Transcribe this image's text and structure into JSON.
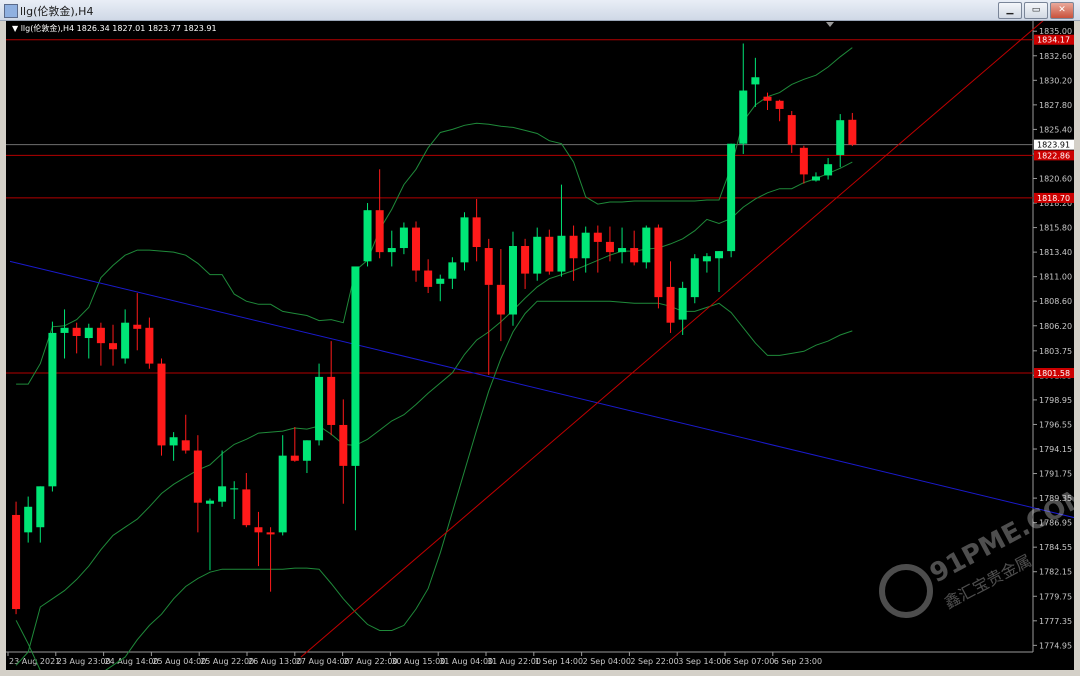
{
  "window": {
    "title": "llg(伦敦金),H4",
    "buttons": [
      "▁",
      "▭",
      "✕"
    ],
    "icons": [
      "minimize-icon",
      "restore-icon",
      "close-icon"
    ]
  },
  "chart_header": {
    "symbol": "llg(伦敦金),H4",
    "ohlc": "1826.34 1827.01 1823.77 1823.91"
  },
  "watermark": {
    "text": "91PME.COM",
    "subtext": "鑫汇宝贵金属"
  },
  "colors": {
    "background": "#000000",
    "bull": "#00e676",
    "bear": "#ff1a1a",
    "bands": "#1f8a3a",
    "hlines": "#b30000",
    "trend_blue": "#1a1acc",
    "trend_red": "#c00000",
    "axis_text": "#c8c8c8"
  },
  "chart_data": {
    "type": "candlestick",
    "title": "llg(伦敦金),H4",
    "ylim": [
      1774.3,
      1836.0
    ],
    "y_ticks": [
      "1835.00",
      "1832.60",
      "1830.20",
      "1827.80",
      "1825.40",
      "1823.00",
      "1820.60",
      "1818.20",
      "1815.80",
      "1813.40",
      "1811.00",
      "1808.60",
      "1806.20",
      "1803.75",
      "1801.35",
      "1798.95",
      "1796.55",
      "1794.15",
      "1791.75",
      "1789.35",
      "1786.95",
      "1784.55",
      "1782.15",
      "1779.75",
      "1777.35",
      "1774.95"
    ],
    "x_labels": [
      "23 Aug 2021",
      "23 Aug 23:00",
      "24 Aug 14:00",
      "25 Aug 04:00",
      "25 Aug 22:00",
      "26 Aug 13:00",
      "27 Aug 04:00",
      "27 Aug 22:00",
      "30 Aug 15:00",
      "31 Aug 04:00",
      "31 Aug 22:00",
      "1 Sep 14:00",
      "2 Sep 04:00",
      "2 Sep 22:00",
      "3 Sep 14:00",
      "6 Sep 07:00",
      "6 Sep 23:00"
    ],
    "price_labels": [
      {
        "price": 1834.17,
        "label": "1834.17",
        "kind": "level"
      },
      {
        "price": 1823.91,
        "label": "1823.91",
        "kind": "current"
      },
      {
        "price": 1822.86,
        "label": "1822.86",
        "kind": "level"
      },
      {
        "price": 1818.7,
        "label": "1818.70",
        "kind": "level"
      },
      {
        "price": 1801.58,
        "label": "1801.58",
        "kind": "level"
      }
    ],
    "candles": [
      {
        "o": 1787.7,
        "h": 1789.0,
        "l": 1778.0,
        "c": 1778.5
      },
      {
        "o": 1786.0,
        "h": 1789.5,
        "l": 1785.0,
        "c": 1788.5
      },
      {
        "o": 1786.5,
        "h": 1790.5,
        "l": 1785.0,
        "c": 1790.5
      },
      {
        "o": 1790.5,
        "h": 1806.6,
        "l": 1790.0,
        "c": 1805.5
      },
      {
        "o": 1805.5,
        "h": 1807.8,
        "l": 1803.0,
        "c": 1806.0
      },
      {
        "o": 1806.0,
        "h": 1806.5,
        "l": 1803.5,
        "c": 1805.2
      },
      {
        "o": 1805.0,
        "h": 1806.4,
        "l": 1803.0,
        "c": 1806.0
      },
      {
        "o": 1806.0,
        "h": 1806.5,
        "l": 1802.3,
        "c": 1804.5
      },
      {
        "o": 1804.5,
        "h": 1806.3,
        "l": 1802.3,
        "c": 1803.9
      },
      {
        "o": 1803.0,
        "h": 1807.8,
        "l": 1802.5,
        "c": 1806.5
      },
      {
        "o": 1806.3,
        "h": 1809.4,
        "l": 1803.8,
        "c": 1805.9
      },
      {
        "o": 1806.0,
        "h": 1807.0,
        "l": 1802.0,
        "c": 1802.5
      },
      {
        "o": 1802.5,
        "h": 1803.0,
        "l": 1793.5,
        "c": 1794.5
      },
      {
        "o": 1794.5,
        "h": 1795.8,
        "l": 1793.0,
        "c": 1795.3
      },
      {
        "o": 1795.0,
        "h": 1797.5,
        "l": 1793.7,
        "c": 1794.0
      },
      {
        "o": 1794.0,
        "h": 1795.5,
        "l": 1786.0,
        "c": 1788.9
      },
      {
        "o": 1788.8,
        "h": 1789.3,
        "l": 1782.3,
        "c": 1789.1
      },
      {
        "o": 1789.0,
        "h": 1794.0,
        "l": 1788.5,
        "c": 1790.5
      },
      {
        "o": 1790.2,
        "h": 1791.0,
        "l": 1787.3,
        "c": 1790.3
      },
      {
        "o": 1790.2,
        "h": 1791.8,
        "l": 1786.5,
        "c": 1786.7
      },
      {
        "o": 1786.5,
        "h": 1788.0,
        "l": 1782.7,
        "c": 1786.0
      },
      {
        "o": 1786.0,
        "h": 1786.5,
        "l": 1780.2,
        "c": 1785.8
      },
      {
        "o": 1786.0,
        "h": 1795.5,
        "l": 1785.7,
        "c": 1793.5
      },
      {
        "o": 1793.5,
        "h": 1796.3,
        "l": 1792.9,
        "c": 1793.0
      },
      {
        "o": 1793.0,
        "h": 1795.0,
        "l": 1791.8,
        "c": 1795.0
      },
      {
        "o": 1795.0,
        "h": 1802.5,
        "l": 1794.5,
        "c": 1801.2
      },
      {
        "o": 1801.2,
        "h": 1804.7,
        "l": 1795.5,
        "c": 1796.5
      },
      {
        "o": 1796.5,
        "h": 1799.0,
        "l": 1788.8,
        "c": 1792.5
      },
      {
        "o": 1792.5,
        "h": 1812.0,
        "l": 1786.2,
        "c": 1812.0
      },
      {
        "o": 1812.5,
        "h": 1818.2,
        "l": 1812.0,
        "c": 1817.5
      },
      {
        "o": 1817.5,
        "h": 1821.5,
        "l": 1812.8,
        "c": 1813.4
      },
      {
        "o": 1813.4,
        "h": 1815.5,
        "l": 1812.0,
        "c": 1813.8
      },
      {
        "o": 1813.8,
        "h": 1816.3,
        "l": 1813.2,
        "c": 1815.8
      },
      {
        "o": 1815.8,
        "h": 1816.4,
        "l": 1810.5,
        "c": 1811.6
      },
      {
        "o": 1811.6,
        "h": 1812.7,
        "l": 1809.4,
        "c": 1810.0
      },
      {
        "o": 1810.3,
        "h": 1811.2,
        "l": 1808.6,
        "c": 1810.8
      },
      {
        "o": 1810.8,
        "h": 1812.9,
        "l": 1809.8,
        "c": 1812.4
      },
      {
        "o": 1812.4,
        "h": 1817.3,
        "l": 1811.6,
        "c": 1816.8
      },
      {
        "o": 1816.8,
        "h": 1818.6,
        "l": 1812.5,
        "c": 1813.9
      },
      {
        "o": 1813.8,
        "h": 1814.7,
        "l": 1801.4,
        "c": 1810.2
      },
      {
        "o": 1810.2,
        "h": 1813.7,
        "l": 1804.7,
        "c": 1807.3
      },
      {
        "o": 1807.3,
        "h": 1815.4,
        "l": 1806.2,
        "c": 1814.0
      },
      {
        "o": 1814.0,
        "h": 1814.7,
        "l": 1809.8,
        "c": 1811.3
      },
      {
        "o": 1811.3,
        "h": 1815.8,
        "l": 1810.6,
        "c": 1814.9
      },
      {
        "o": 1814.9,
        "h": 1815.6,
        "l": 1811.2,
        "c": 1811.5
      },
      {
        "o": 1811.5,
        "h": 1820.0,
        "l": 1811.0,
        "c": 1815.0
      },
      {
        "o": 1815.0,
        "h": 1816.0,
        "l": 1810.6,
        "c": 1812.8
      },
      {
        "o": 1812.8,
        "h": 1815.9,
        "l": 1811.4,
        "c": 1815.3
      },
      {
        "o": 1815.3,
        "h": 1816.0,
        "l": 1811.4,
        "c": 1814.4
      },
      {
        "o": 1814.4,
        "h": 1815.9,
        "l": 1812.5,
        "c": 1813.4
      },
      {
        "o": 1813.4,
        "h": 1815.8,
        "l": 1812.3,
        "c": 1813.8
      },
      {
        "o": 1813.8,
        "h": 1815.5,
        "l": 1812.1,
        "c": 1812.4
      },
      {
        "o": 1812.4,
        "h": 1816.0,
        "l": 1811.8,
        "c": 1815.8
      },
      {
        "o": 1815.8,
        "h": 1816.1,
        "l": 1807.9,
        "c": 1809.0
      },
      {
        "o": 1810.0,
        "h": 1812.5,
        "l": 1805.5,
        "c": 1806.5
      },
      {
        "o": 1806.8,
        "h": 1810.5,
        "l": 1805.3,
        "c": 1809.9
      },
      {
        "o": 1809.0,
        "h": 1813.2,
        "l": 1808.4,
        "c": 1812.8
      },
      {
        "o": 1812.5,
        "h": 1813.3,
        "l": 1811.4,
        "c": 1813.0
      },
      {
        "o": 1812.8,
        "h": 1813.5,
        "l": 1809.5,
        "c": 1813.5
      },
      {
        "o": 1813.5,
        "h": 1824.0,
        "l": 1812.9,
        "c": 1824.0
      },
      {
        "o": 1824.0,
        "h": 1833.8,
        "l": 1823.0,
        "c": 1829.2
      },
      {
        "o": 1829.8,
        "h": 1832.4,
        "l": 1827.6,
        "c": 1830.5
      },
      {
        "o": 1828.6,
        "h": 1829.0,
        "l": 1827.3,
        "c": 1828.2
      },
      {
        "o": 1828.2,
        "h": 1828.3,
        "l": 1826.2,
        "c": 1827.4
      },
      {
        "o": 1826.8,
        "h": 1827.2,
        "l": 1823.1,
        "c": 1823.9
      },
      {
        "o": 1823.6,
        "h": 1823.8,
        "l": 1820.1,
        "c": 1821.0
      },
      {
        "o": 1820.4,
        "h": 1821.2,
        "l": 1820.3,
        "c": 1820.8
      },
      {
        "o": 1820.9,
        "h": 1822.6,
        "l": 1820.5,
        "c": 1822.0
      },
      {
        "o": 1822.9,
        "h": 1826.9,
        "l": 1821.7,
        "c": 1826.3
      },
      {
        "o": 1826.34,
        "h": 1827.01,
        "l": 1823.77,
        "c": 1823.91
      }
    ],
    "bollinger": {
      "upper": [
        1800.5,
        1800.5,
        1802.5,
        1806.1,
        1806.2,
        1806.8,
        1808.0,
        1810.9,
        1812.1,
        1813.1,
        1813.6,
        1813.6,
        1813.5,
        1813.4,
        1813.1,
        1812.3,
        1811.2,
        1811.2,
        1809.3,
        1808.6,
        1808.3,
        1808.3,
        1807.6,
        1807.4,
        1807.2,
        1806.7,
        1806.8,
        1806.5,
        1811.6,
        1812.6,
        1815.6,
        1817.6,
        1820.0,
        1821.5,
        1823.6,
        1825.1,
        1825.4,
        1825.8,
        1826.0,
        1825.9,
        1825.7,
        1825.6,
        1825.3,
        1825.0,
        1824.3,
        1824.0,
        1822.2,
        1818.8,
        1818.1,
        1818.3,
        1818.3,
        1818.4,
        1818.4,
        1818.4,
        1818.4,
        1818.4,
        1818.4,
        1818.5,
        1818.5,
        1821.7,
        1826.2,
        1827.8,
        1828.6,
        1829.0,
        1829.8,
        1830.3,
        1830.7,
        1831.5,
        1832.5,
        1833.4
      ],
      "lower": [
        1773.0,
        1774.3,
        1778.7,
        1779.5,
        1780.3,
        1781.4,
        1782.7,
        1784.3,
        1785.7,
        1786.5,
        1787.3,
        1788.5,
        1789.8,
        1790.7,
        1791.4,
        1792.1,
        1792.6,
        1793.7,
        1794.6,
        1795.1,
        1795.7,
        1795.8,
        1795.9,
        1796.2,
        1796.1,
        1796.4,
        1795.6,
        1794.6,
        1794.5,
        1795.1,
        1796.0,
        1796.9,
        1797.5,
        1798.5,
        1799.6,
        1800.6,
        1801.6,
        1803.4,
        1804.8,
        1805.6,
        1806.6,
        1807.7,
        1808.9,
        1810.0,
        1810.8,
        1811.2,
        1811.6,
        1812.1,
        1812.6,
        1813.1,
        1813.5,
        1813.5,
        1813.7,
        1813.8,
        1814.2,
        1814.7,
        1815.5,
        1816.6,
        1816.2,
        1816.7,
        1817.8,
        1818.6,
        1819.2,
        1819.6,
        1819.6,
        1820.2,
        1820.6,
        1821.1,
        1821.6,
        1822.2
      ],
      "lower_band": [
        1777.4,
        1775.1,
        1772.5,
        1771.5,
        1770.5,
        1770.0,
        1770.2,
        1772.2,
        1773.0,
        1773.8,
        1775.5,
        1776.9,
        1778.0,
        1779.5,
        1780.7,
        1781.5,
        1782.1,
        1782.4,
        1782.4,
        1782.4,
        1782.4,
        1782.4,
        1782.4,
        1782.5,
        1782.5,
        1782.4,
        1781.0,
        1779.5,
        1778.2,
        1777.0,
        1776.4,
        1776.4,
        1776.9,
        1778.5,
        1780.5,
        1784.0,
        1788.0,
        1792.0,
        1796.0,
        1799.8,
        1803.0,
        1805.6,
        1807.4,
        1808.6,
        1808.6,
        1808.6,
        1808.6,
        1808.6,
        1808.6,
        1808.6,
        1808.5,
        1808.4,
        1808.4,
        1808.4,
        1808.1,
        1807.6,
        1807.6,
        1808.0,
        1808.4,
        1807.5,
        1806.0,
        1804.5,
        1803.3,
        1803.3,
        1803.5,
        1803.7,
        1804.3,
        1804.7,
        1805.3,
        1805.7
      ]
    },
    "h_levels": [
      1834.17,
      1822.86,
      1818.7,
      1801.58
    ],
    "current_price": 1823.91,
    "trendlines": [
      {
        "name": "blue",
        "from": {
          "bar": 0,
          "price": 1812.5
        },
        "to": {
          "bar": 89,
          "price": 1787.1
        }
      },
      {
        "name": "red",
        "from": {
          "bar": 24,
          "price": 1773.8
        },
        "to": {
          "bar": 86,
          "price": 1836.8
        }
      }
    ]
  }
}
